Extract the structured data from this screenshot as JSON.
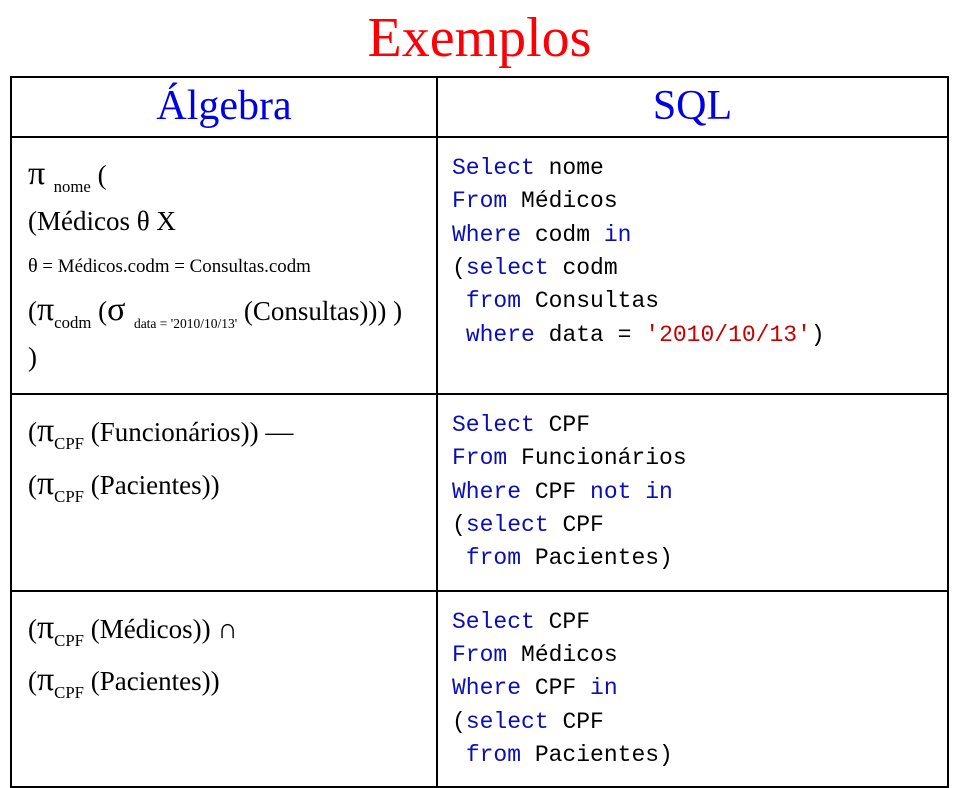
{
  "title": "Exemplos",
  "headers": {
    "left": "Álgebra",
    "right": "SQL"
  },
  "rows": [
    {
      "alg": {
        "l1_pi": "π ",
        "l1_sub": "nome",
        "l1_open": " (",
        "l2_open": "(Médicos ",
        "l2_theta": "θ",
        "l2_x": " X",
        "l3_theta": "θ",
        "l3_eq": " = Médicos.codm = Consultas.codm",
        "l4_open": "(",
        "l4_pi": "π",
        "l4_sub1": "codm",
        "l4_mid": " (",
        "l4_sigma": "σ ",
        "l4_sub2": "data = '2010/10/13'",
        "l4_close": " (Consultas))) )",
        "l5_close": ")"
      },
      "sql": {
        "k1": "Select ",
        "t1": "nome",
        "k2": "From ",
        "t2": "Médicos",
        "k3": "Where ",
        "t3": "codm ",
        "k3b": "in",
        "p1": "(",
        "k4": "select ",
        "t4": "codm",
        "sp": " ",
        "k5": "from ",
        "t5": "Consultas",
        "k6": "where ",
        "t6": "data = ",
        "lit": "'2010/10/13'",
        "p2": ")"
      }
    },
    {
      "alg": {
        "l1_open": "(",
        "l1_pi": "π",
        "l1_sub": "CPF",
        "l1_body": " (Funcionários)) ",
        "l1_op": "—",
        "l2_open": "(",
        "l2_pi": "π",
        "l2_sub": "CPF",
        "l2_body": " (Pacientes))"
      },
      "sql": {
        "k1": "Select ",
        "t1": "CPF",
        "k2": "From ",
        "t2": "Funcionários",
        "k3": "Where ",
        "t3": "CPF ",
        "k3b": "not in",
        "p1": "(",
        "k4": "select ",
        "t4": "CPF",
        "sp": " ",
        "k5": "from ",
        "t5": "Pacientes)",
        "p2": ""
      }
    },
    {
      "alg": {
        "l1_open": "(",
        "l1_pi": "π",
        "l1_sub": "CPF",
        "l1_body": " (Médicos)) ",
        "l1_op": "∩",
        "l2_open": "(",
        "l2_pi": "π",
        "l2_sub": "CPF",
        "l2_body": " (Pacientes))"
      },
      "sql": {
        "k1": "Select ",
        "t1": "CPF",
        "k2": "From ",
        "t2": "Médicos",
        "k3": "Where ",
        "t3": "CPF ",
        "k3b": "in",
        "p1": "(",
        "k4": "select ",
        "t4": "CPF",
        "sp": " ",
        "k5": "from ",
        "t5": "Pacientes)",
        "p2": ""
      }
    }
  ]
}
